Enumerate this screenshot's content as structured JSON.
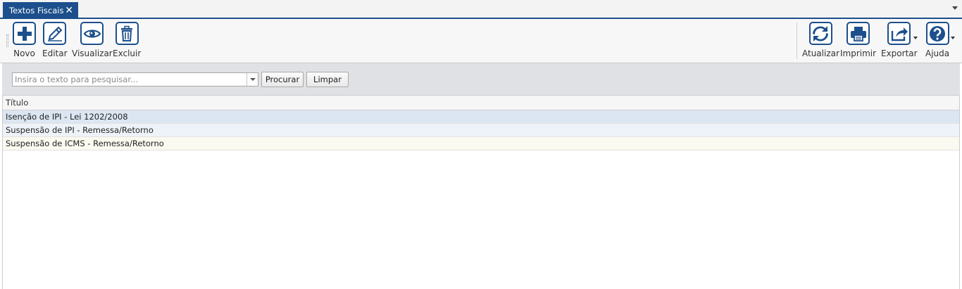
{
  "tab": {
    "title": "Textos Fiscais",
    "close": "✕"
  },
  "toolbar": {
    "left": [
      {
        "label": "Novo",
        "icon": "plus-icon"
      },
      {
        "label": "Editar",
        "icon": "pencil-icon"
      },
      {
        "label": "Visualizar",
        "icon": "eye-icon"
      },
      {
        "label": "Excluir",
        "icon": "trash-icon"
      }
    ],
    "right": [
      {
        "label": "Atualizar",
        "icon": "refresh-icon"
      },
      {
        "label": "Imprimir",
        "icon": "printer-icon"
      },
      {
        "label": "Exportar",
        "icon": "export-icon"
      },
      {
        "label": "Ajuda",
        "icon": "help-icon"
      }
    ]
  },
  "search": {
    "placeholder": "Insira o texto para pesquisar...",
    "value": "",
    "search_label": "Procurar",
    "clear_label": "Limpar"
  },
  "grid": {
    "column": "Título",
    "rows": [
      "Isenção de IPI - Lei 1202/2008",
      "Suspensão de IPI - Remessa/Retorno",
      "Suspensão de ICMS - Remessa/Retorno"
    ]
  },
  "colors": {
    "accent": "#1c4f8c",
    "selected_row": "#dce6f2"
  }
}
